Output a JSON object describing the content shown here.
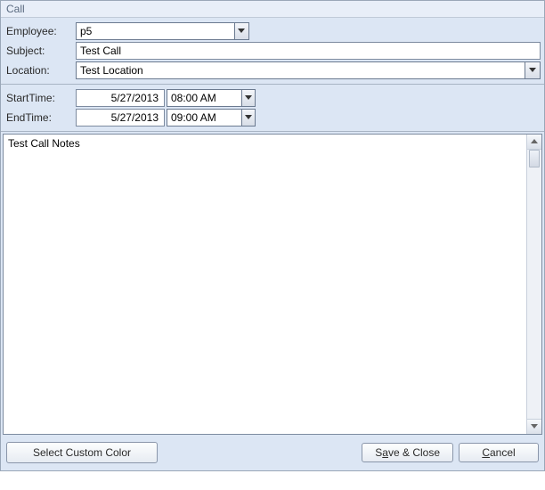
{
  "window": {
    "title": "Call"
  },
  "fields": {
    "employee_label": "Employee:",
    "employee_value": "p5",
    "subject_label": "Subject:",
    "subject_value": "Test Call",
    "location_label": "Location:",
    "location_value": "Test Location",
    "starttime_label": "StartTime:",
    "start_date": "5/27/2013",
    "start_time": "08:00 AM",
    "endtime_label": "EndTime:",
    "end_date": "5/27/2013",
    "end_time": "09:00 AM"
  },
  "notes": {
    "value": "Test Call Notes"
  },
  "buttons": {
    "select_color": "Select Custom Color",
    "save_close_pre": "S",
    "save_close_u": "a",
    "save_close_post": "ve & Close",
    "cancel_pre": "",
    "cancel_u": "C",
    "cancel_post": "ancel"
  }
}
